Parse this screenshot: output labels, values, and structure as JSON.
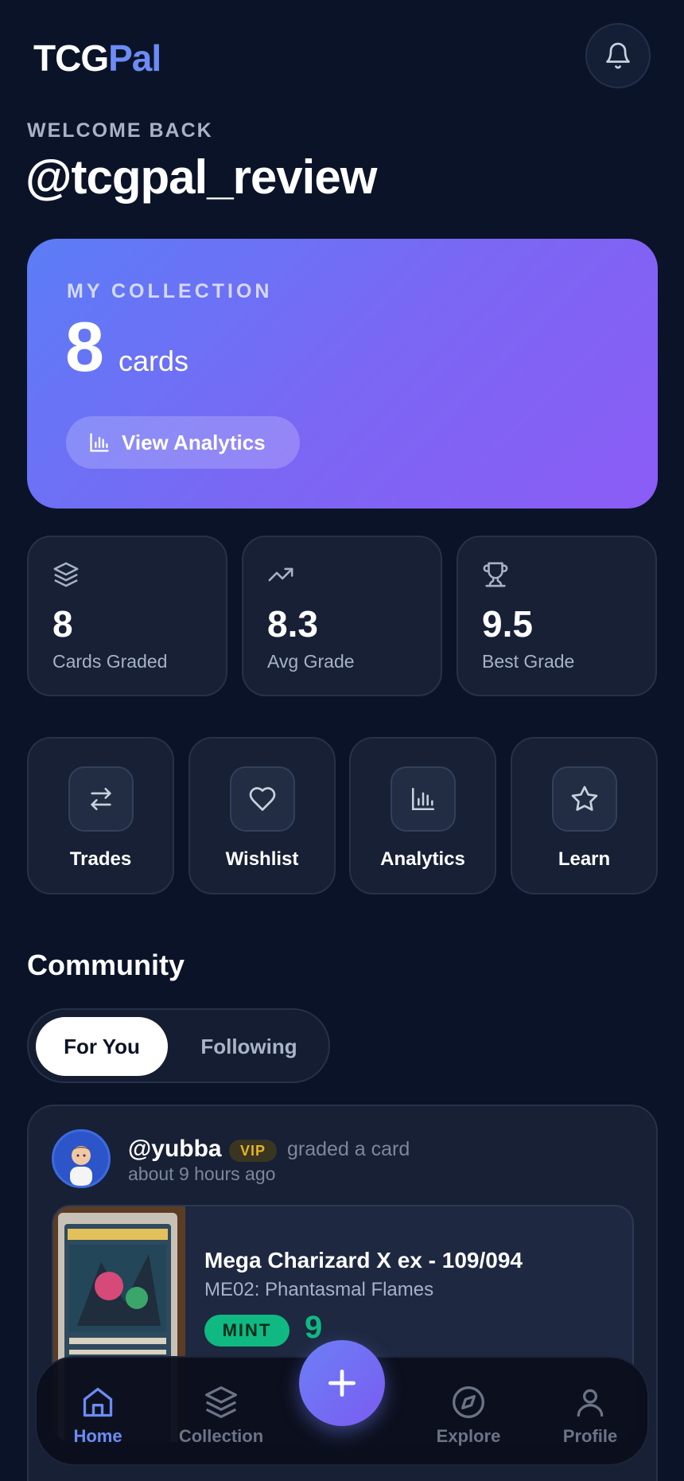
{
  "header": {
    "logo_part1": "TCG",
    "logo_part2": "Pal",
    "welcome_label": "WELCOME BACK",
    "username": "@tcgpal_review"
  },
  "collection": {
    "label": "MY COLLECTION",
    "count": "8",
    "unit": "cards",
    "analytics_button": "View Analytics"
  },
  "stats": [
    {
      "icon": "layers-icon",
      "value": "8",
      "label": "Cards Graded"
    },
    {
      "icon": "trending-up-icon",
      "value": "8.3",
      "label": "Avg Grade"
    },
    {
      "icon": "trophy-icon",
      "value": "9.5",
      "label": "Best Grade"
    }
  ],
  "quick_actions": [
    {
      "icon": "swap-arrows-icon",
      "label": "Trades"
    },
    {
      "icon": "heart-icon",
      "label": "Wishlist"
    },
    {
      "icon": "bar-chart-icon",
      "label": "Analytics"
    },
    {
      "icon": "star-icon",
      "label": "Learn"
    }
  ],
  "community": {
    "title": "Community",
    "tabs": [
      "For You",
      "Following"
    ],
    "active_tab": "For You"
  },
  "feed": [
    {
      "user": "@yubba",
      "badge": "VIP",
      "action": "graded a card",
      "time": "about 9 hours ago",
      "card_name": "Mega Charizard X ex - 109/094",
      "card_set": "ME02: Phantasmal Flames",
      "condition": "MINT",
      "grade": "9"
    }
  ],
  "nav": {
    "items": [
      {
        "icon": "home-icon",
        "label": "Home",
        "active": true
      },
      {
        "icon": "layers-icon",
        "label": "Collection",
        "active": false
      },
      {
        "icon": "compass-icon",
        "label": "Explore",
        "active": false
      },
      {
        "icon": "user-icon",
        "label": "Profile",
        "active": false
      }
    ],
    "fab_icon": "plus-icon"
  },
  "colors": {
    "background": "#0b1328",
    "accent": "#6c8cf5",
    "mint": "#10b981",
    "vip": "#e6b422"
  }
}
